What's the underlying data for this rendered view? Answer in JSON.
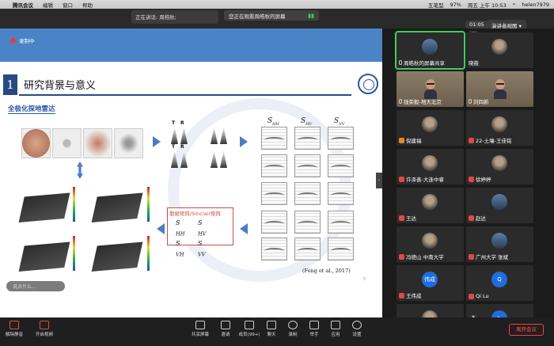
{
  "menubar": {
    "app_name": "腾讯会议",
    "menus": [
      "编辑",
      "窗口",
      "帮助"
    ],
    "ime": "五笔型",
    "battery": "97%",
    "clock": "周五 上午 10:53",
    "user": "helen7979"
  },
  "titlebar": {
    "speaking_label": "正在讲话: 周皓秋;",
    "share_notice": "您正在观看周皓秋的屏幕",
    "timer": "01:05",
    "view_button": "演讲者视图"
  },
  "slide": {
    "recording": "录制中",
    "section_number": "1",
    "section_title": "研究背景与意义",
    "subheading": "全极化探地雷达",
    "antenna_labels": [
      "T",
      "R",
      "T",
      "R"
    ],
    "s_headers": [
      "S",
      "S",
      "S"
    ],
    "s_subs": [
      "HH",
      "HV",
      "VV"
    ],
    "matrix_title": "散射矩阵/Sinclair矩阵",
    "matrix": [
      [
        "S",
        "HH",
        "S",
        "HV"
      ],
      [
        "S",
        "VH",
        "S",
        "VV"
      ]
    ],
    "citation": "(Feng et al., 2017)",
    "page_number": "5"
  },
  "chat": {
    "placeholder": "说点什么..."
  },
  "gallery": {
    "participants": [
      {
        "name": "周皓秋的屏幕共享",
        "mic": "ok",
        "avatar": "photoB",
        "active": true
      },
      {
        "name": "晓筱",
        "mic": "none",
        "avatar": "photoA"
      },
      {
        "name": "钱荣毅-地大北京",
        "mic": "ok",
        "avatar": "video"
      },
      {
        "name": "刘四新",
        "mic": "ok",
        "avatar": "video"
      },
      {
        "name": "倪建福",
        "mic": "org",
        "avatar": "photoA"
      },
      {
        "name": "22-土壤-王佳铭",
        "mic": "muted",
        "avatar": "photoA"
      },
      {
        "name": "许泽善-大连中睿",
        "mic": "muted",
        "avatar": "photoA"
      },
      {
        "name": "徐婷婷",
        "mic": "muted",
        "avatar": "photoA"
      },
      {
        "name": "王达",
        "mic": "muted",
        "avatar": "photoA"
      },
      {
        "name": "赵达",
        "mic": "muted",
        "avatar": "photoB"
      },
      {
        "name": "冯德山 中南大学",
        "mic": "muted",
        "avatar": "photoA"
      },
      {
        "name": "广州大学 张斌",
        "mic": "muted",
        "avatar": "photoB"
      },
      {
        "name": "王伟成",
        "mic": "muted",
        "avatar": "blue",
        "initials": "伟成"
      },
      {
        "name": "Qi Lu",
        "mic": "muted",
        "avatar": "blue",
        "initials": "Q"
      },
      {
        "name": "",
        "mic": "none",
        "avatar": "photoA"
      },
      {
        "name": "",
        "mic": "none",
        "avatar": "blue",
        "initials": "L"
      }
    ]
  },
  "toolbar": {
    "mute": "解除静音",
    "video": "开启视频",
    "share": "共享屏幕",
    "invite": "邀请",
    "members": "成员(99+)",
    "chat": "聊天",
    "record": "录制",
    "raise_hand": "举手",
    "apps": "应用",
    "settings": "设置",
    "leave": "离开会议"
  }
}
